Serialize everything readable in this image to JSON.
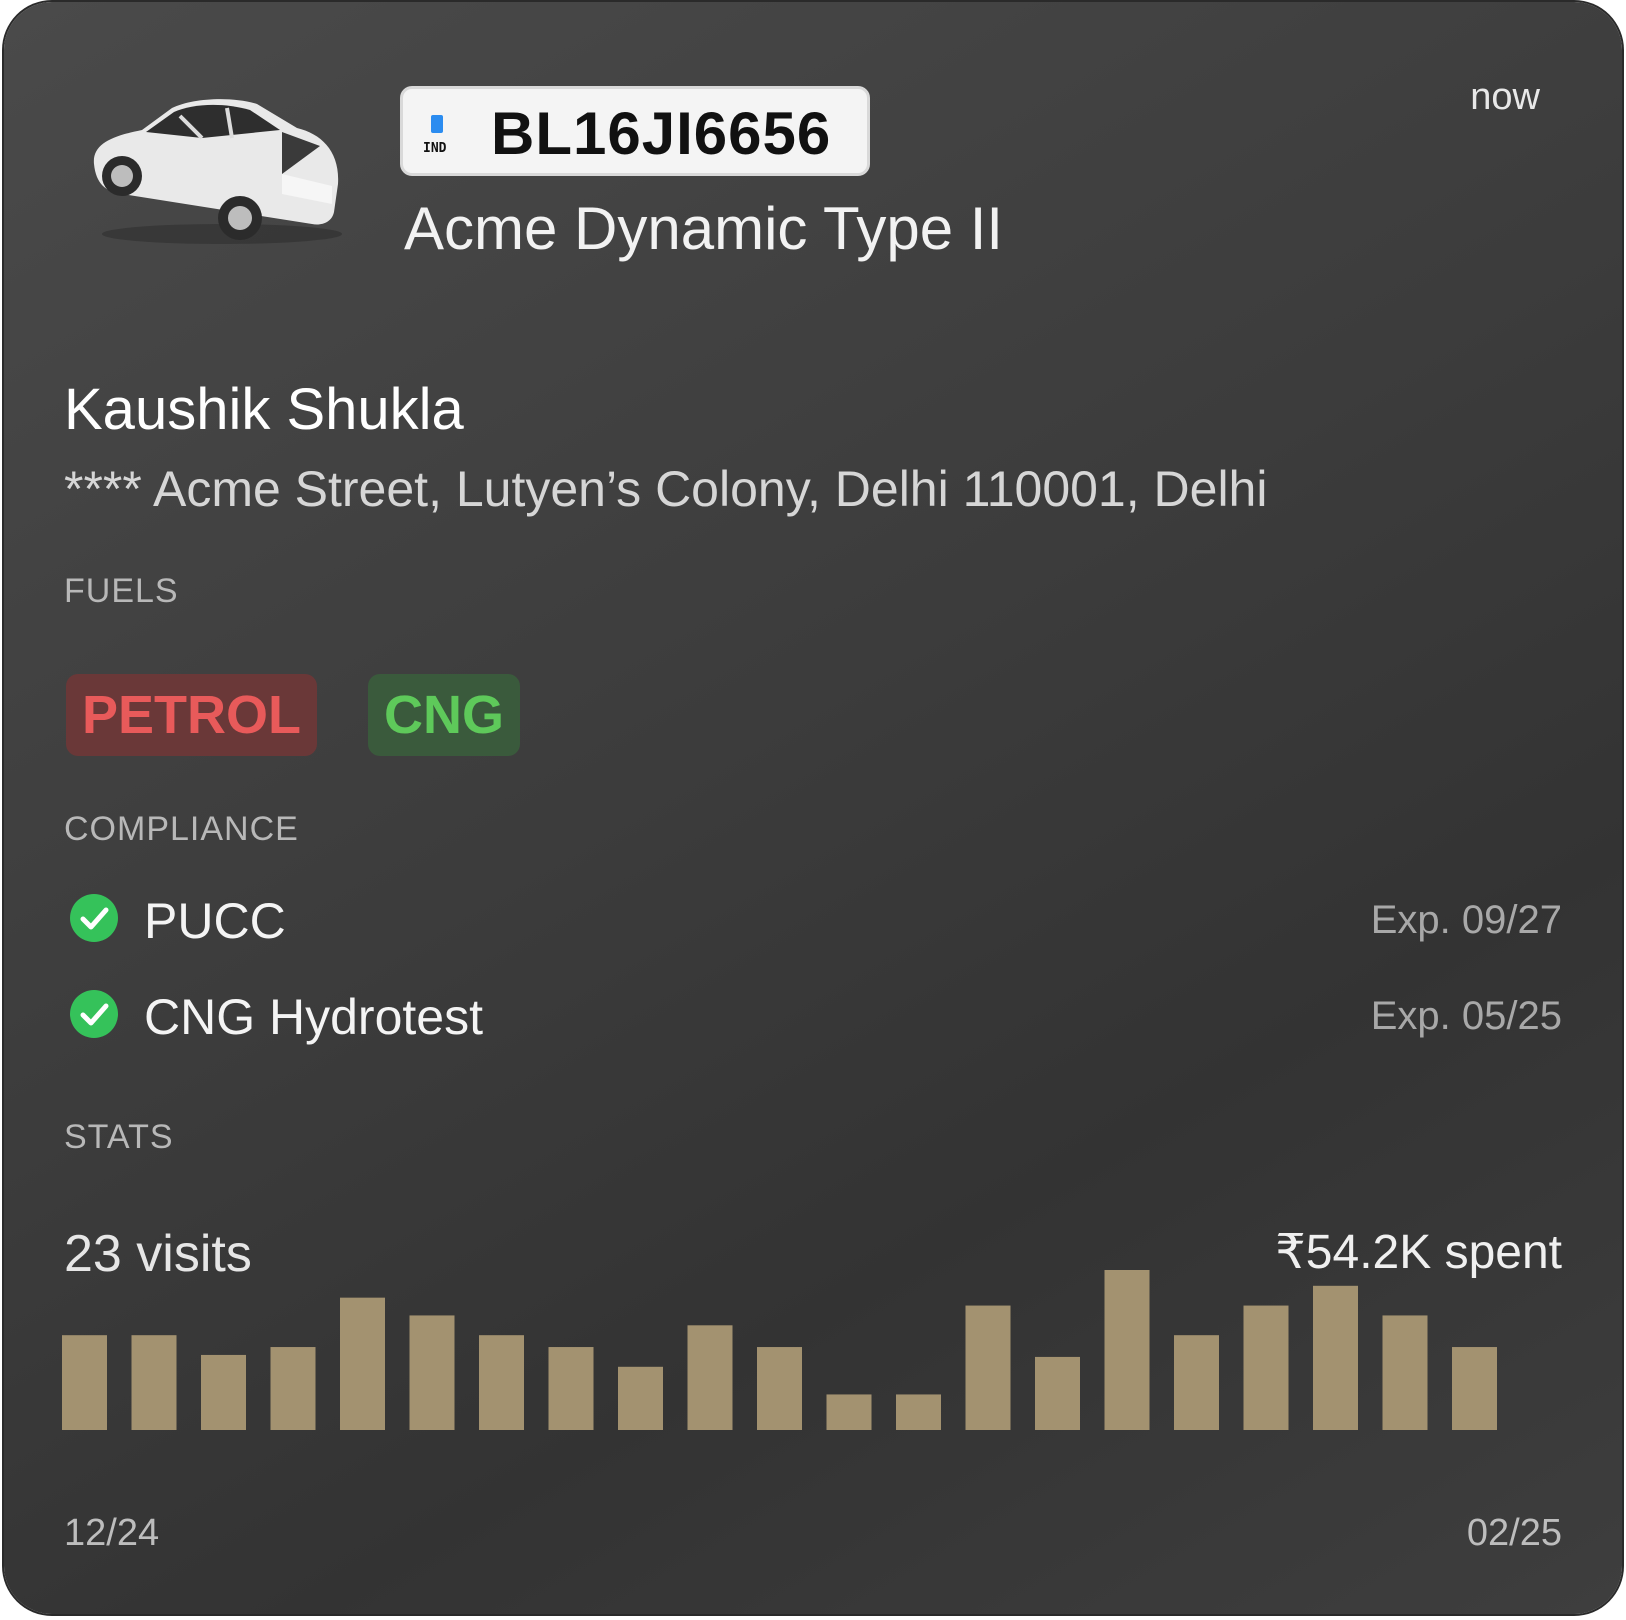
{
  "vehicle": {
    "plate_country": "IND",
    "plate_number": "BL16JI6656",
    "model": "Acme Dynamic Type II",
    "timestamp": "now"
  },
  "owner": {
    "name": "Kaushik Shukla",
    "address": "**** Acme Street, Lutyen’s Colony, Delhi 110001, Delhi"
  },
  "fuels": {
    "label": "FUELS",
    "items": [
      {
        "name": "PETROL",
        "color": "#e85a5a",
        "bg": "#6a3838"
      },
      {
        "name": "CNG",
        "color": "#5ec95a",
        "bg": "#3a5a3c"
      }
    ]
  },
  "compliance": {
    "label": "COMPLIANCE",
    "items": [
      {
        "name": "PUCC",
        "expiry": "Exp. 09/27",
        "status": "valid"
      },
      {
        "name": "CNG Hydrotest",
        "expiry": "Exp. 05/25",
        "status": "valid"
      }
    ]
  },
  "stats": {
    "label": "STATS",
    "visits": "23 visits",
    "spent": "₹54.2K spent"
  },
  "chart_data": {
    "type": "bar",
    "values": [
      48,
      48,
      38,
      42,
      67,
      58,
      48,
      42,
      32,
      53,
      42,
      18,
      18,
      63,
      37,
      81,
      48,
      63,
      73,
      58,
      42
    ],
    "x_start_label": "12/24",
    "x_end_label": "02/25",
    "bar_color": "#a39270"
  }
}
